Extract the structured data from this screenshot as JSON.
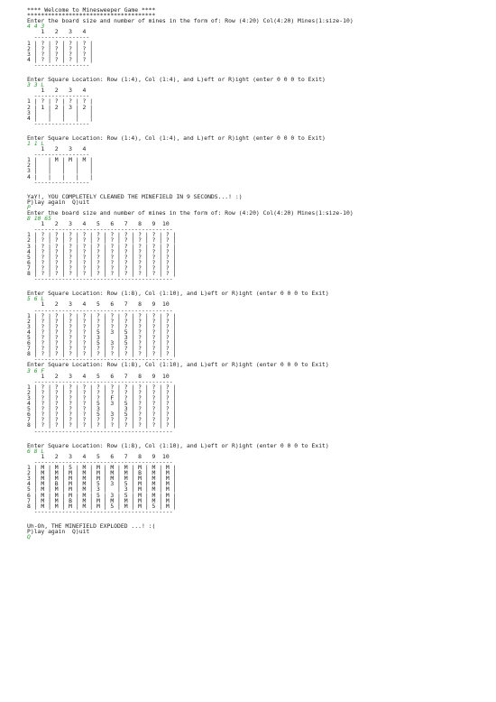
{
  "terminal": {
    "blocks": [
      {
        "kind": "out",
        "text": "**** Welcome to Minesweeper Game ****"
      },
      {
        "kind": "out",
        "text": "*************************************"
      },
      {
        "kind": "out",
        "text": "Enter the board size and number of mines in the form of: Row (4:20) Col(4:20) Mines(1:size-10)"
      },
      {
        "kind": "in",
        "text": "4 4 3"
      },
      {
        "kind": "out",
        "text": "    1   2   3   4"
      },
      {
        "kind": "out",
        "text": "  ----------------"
      },
      {
        "kind": "out",
        "text": "1 | ? | ? | ? | ? |"
      },
      {
        "kind": "out",
        "text": "2 | ? | ? | ? | ? |"
      },
      {
        "kind": "out",
        "text": "3 | ? | ? | ? | ? |"
      },
      {
        "kind": "out",
        "text": "4 | ? | ? | ? | ? |"
      },
      {
        "kind": "out",
        "text": "  ----------------"
      },
      {
        "kind": "gap"
      },
      {
        "kind": "out",
        "text": "Enter Square Location: Row (1:4), Col (1:4), and L)eft or R)ight (enter 0 0 0 to Exit)"
      },
      {
        "kind": "in",
        "text": "3 3 L"
      },
      {
        "kind": "out",
        "text": "    1   2   3   4"
      },
      {
        "kind": "out",
        "text": "  ----------------"
      },
      {
        "kind": "out",
        "text": "1 | ? | ? | ? | ? |"
      },
      {
        "kind": "out",
        "text": "2 | 1 | 2 | 3 | 2 |"
      },
      {
        "kind": "out",
        "text": "3 |   |   |   |   |"
      },
      {
        "kind": "out",
        "text": "4 |   |   |   |   |"
      },
      {
        "kind": "out",
        "text": "  ----------------"
      },
      {
        "kind": "gap"
      },
      {
        "kind": "out",
        "text": "Enter Square Location: Row (1:4), Col (1:4), and L)eft or R)ight (enter 0 0 0 to Exit)"
      },
      {
        "kind": "in",
        "text": "1 1 L"
      },
      {
        "kind": "out",
        "text": "    1   2   3   4"
      },
      {
        "kind": "out",
        "text": "  ----------------"
      },
      {
        "kind": "out",
        "text": "1 |   | M | M | M |"
      },
      {
        "kind": "out",
        "text": "2 |   |   |   |   |"
      },
      {
        "kind": "out",
        "text": "3 |   |   |   |   |"
      },
      {
        "kind": "out",
        "text": "4 |   |   |   |   |"
      },
      {
        "kind": "out",
        "text": "  ----------------"
      },
      {
        "kind": "gap"
      },
      {
        "kind": "out",
        "text": "YaY!, YOU COMPLETELY CLEANED THE MINEFIELD IN 9 SECONDS...! :)"
      },
      {
        "kind": "out",
        "text": "P)lay again  Q)uit"
      },
      {
        "kind": "in",
        "text": "P"
      },
      {
        "kind": "out",
        "text": "Enter the board size and number of mines in the form of: Row (4:20) Col(4:20) Mines(1:size-10)"
      },
      {
        "kind": "in",
        "text": "8 10 65"
      },
      {
        "kind": "out",
        "text": "    1   2   3   4   5   6   7   8   9  10"
      },
      {
        "kind": "out",
        "text": "  ----------------------------------------"
      },
      {
        "kind": "out",
        "text": "1 | ? | ? | ? | ? | ? | ? | ? | ? | ? | ? |"
      },
      {
        "kind": "out",
        "text": "2 | ? | ? | ? | ? | ? | ? | ? | ? | ? | ? |"
      },
      {
        "kind": "out",
        "text": "3 | ? | ? | ? | ? | ? | ? | ? | ? | ? | ? |"
      },
      {
        "kind": "out",
        "text": "4 | ? | ? | ? | ? | ? | ? | ? | ? | ? | ? |"
      },
      {
        "kind": "out",
        "text": "5 | ? | ? | ? | ? | ? | ? | ? | ? | ? | ? |"
      },
      {
        "kind": "out",
        "text": "6 | ? | ? | ? | ? | ? | ? | ? | ? | ? | ? |"
      },
      {
        "kind": "out",
        "text": "7 | ? | ? | ? | ? | ? | ? | ? | ? | ? | ? |"
      },
      {
        "kind": "out",
        "text": "8 | ? | ? | ? | ? | ? | ? | ? | ? | ? | ? |"
      },
      {
        "kind": "out",
        "text": "  ----------------------------------------"
      },
      {
        "kind": "gap"
      },
      {
        "kind": "out",
        "text": "Enter Square Location: Row (1:8), Col (1:10), and L)eft or R)ight (enter 0 0 0 to Exit)"
      },
      {
        "kind": "in",
        "text": "5 6 L"
      },
      {
        "kind": "out",
        "text": "    1   2   3   4   5   6   7   8   9  10"
      },
      {
        "kind": "out",
        "text": "  ----------------------------------------"
      },
      {
        "kind": "out",
        "text": "1 | ? | ? | ? | ? | ? | ? | ? | ? | ? | ? |"
      },
      {
        "kind": "out",
        "text": "2 | ? | ? | ? | ? | ? | ? | ? | ? | ? | ? |"
      },
      {
        "kind": "out",
        "text": "3 | ? | ? | ? | ? | ? | ? | ? | ? | ? | ? |"
      },
      {
        "kind": "out",
        "text": "4 | ? | ? | ? | ? | 5 | 3 | 5 | ? | ? | ? |"
      },
      {
        "kind": "out",
        "text": "5 | ? | ? | ? | ? | 3 |   | 3 | ? | ? | ? |"
      },
      {
        "kind": "out",
        "text": "6 | ? | ? | ? | ? | 5 | 3 | 5 | ? | ? | ? |"
      },
      {
        "kind": "out",
        "text": "7 | ? | ? | ? | ? | ? | ? | ? | ? | ? | ? |"
      },
      {
        "kind": "out",
        "text": "8 | ? | ? | ? | ? | ? | ? | ? | ? | ? | ? |"
      },
      {
        "kind": "out",
        "text": "  ----------------------------------------"
      },
      {
        "kind": "out",
        "text": "Enter Square Location: Row (1:8), Col (1:10), and L)eft or R)ight (enter 0 0 0 to Exit)"
      },
      {
        "kind": "in",
        "text": "3 6 F"
      },
      {
        "kind": "out",
        "text": "    1   2   3   4   5   6   7   8   9  10"
      },
      {
        "kind": "out",
        "text": "  ----------------------------------------"
      },
      {
        "kind": "out",
        "text": "1 | ? | ? | ? | ? | ? | ? | ? | ? | ? | ? |"
      },
      {
        "kind": "out",
        "text": "2 | ? | ? | ? | ? | ? | ? | ? | ? | ? | ? |"
      },
      {
        "kind": "out",
        "text": "3 | ? | ? | ? | ? | ? | F | ? | ? | ? | ? |"
      },
      {
        "kind": "out",
        "text": "4 | ? | ? | ? | ? | 5 | 3 | 5 | ? | ? | ? |"
      },
      {
        "kind": "out",
        "text": "5 | ? | ? | ? | ? | 3 |   | 3 | ? | ? | ? |"
      },
      {
        "kind": "out",
        "text": "6 | ? | ? | ? | ? | 5 | 3 | 5 | ? | ? | ? |"
      },
      {
        "kind": "out",
        "text": "7 | ? | ? | ? | ? | ? | ? | ? | ? | ? | ? |"
      },
      {
        "kind": "out",
        "text": "8 | ? | ? | ? | ? | ? | ? | ? | ? | ? | ? |"
      },
      {
        "kind": "out",
        "text": "  ----------------------------------------"
      },
      {
        "kind": "gap"
      },
      {
        "kind": "out",
        "text": "Enter Square Location: Row (1:8), Col (1:10), and L)eft or R)ight (enter 0 0 0 to Exit)"
      },
      {
        "kind": "in",
        "text": "6 8 L"
      },
      {
        "kind": "out",
        "text": "    1   2   3   4   5   6   7   8   9  10"
      },
      {
        "kind": "out",
        "text": "  ----------------------------------------"
      },
      {
        "kind": "out",
        "text": "1 | M | M | 5 | M | M | M | M | M | M | M |"
      },
      {
        "kind": "out",
        "text": "2 | M | M | M | M | M | M | M | B | M | M |"
      },
      {
        "kind": "out",
        "text": "3 | M | M | M | M | M | M | M | M | M | M |"
      },
      {
        "kind": "out",
        "text": "4 | M | B | M | M | 5 | 3 | 5 | M | M | M |"
      },
      {
        "kind": "out",
        "text": "5 | M | M | M | M | 3 |   | 3 | M | M | M |"
      },
      {
        "kind": "out",
        "text": "6 | M | M | M | M | 5 | 3 | 5 | M | M | M |"
      },
      {
        "kind": "out",
        "text": "7 | M | M | B | M | M | M | M | M | M | M |"
      },
      {
        "kind": "out",
        "text": "8 | M | M | M | M | M | 5 | M | M | 5 | M |"
      },
      {
        "kind": "out",
        "text": "  ----------------------------------------"
      },
      {
        "kind": "gap"
      },
      {
        "kind": "out",
        "text": "Uh-Oh, THE MINEFIELD EXPLODED ...! :("
      },
      {
        "kind": "out",
        "text": "P)lay again  Q)uit"
      },
      {
        "kind": "in",
        "text": "Q"
      }
    ]
  }
}
